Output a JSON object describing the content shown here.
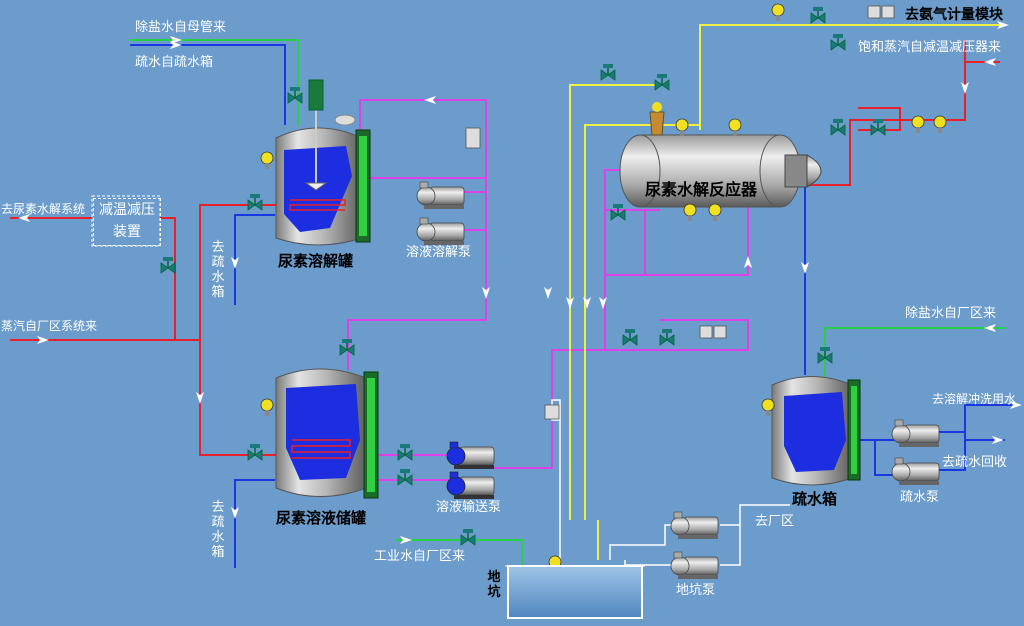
{
  "labels": {
    "desalt_main": "除盐水自母管来",
    "hydro_tank": "疏水自疏水箱",
    "to_urea_hydro": "去尿素水解系统",
    "desuper": "减温减压装置",
    "steam_from_plant": "蒸汽自厂区系统来",
    "to_drain_1": "去疏水箱",
    "to_drain_2": "去疏水箱",
    "dissolve_tank": "尿素溶解罐",
    "dissolve_pump": "溶液溶解泵",
    "storage_tank": "尿素溶液储罐",
    "transfer_pump": "溶液输送泵",
    "industrial_water": "工业水自厂区来",
    "pit": "地坑",
    "pit_pump": "地坑泵",
    "to_plant": "去厂区",
    "reactor": "尿素水解反应器",
    "to_ammonia": "去氨气计量模块",
    "sat_steam": "饱和蒸汽自减温减压器来",
    "desalt_plant": "除盐水自厂区来",
    "to_flush": "去溶解冲洗用水",
    "drain_return": "去疏水回收",
    "drain_tank": "疏水箱",
    "drain_pump": "疏水泵"
  },
  "colors": {
    "background": "#6b9ccc",
    "steam_line": "#e8202a",
    "solution_line": "#e040e8",
    "water_line": "#1838e0",
    "desalt_line": "#28d048",
    "gas_line": "#f0f040",
    "tank_fill": "#1c2ee0",
    "valve": "#1a7a7a"
  }
}
